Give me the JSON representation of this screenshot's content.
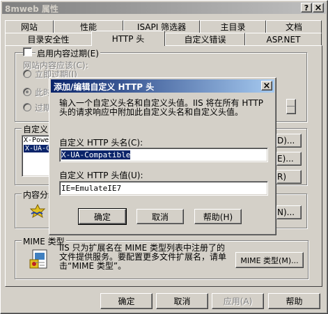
{
  "window": {
    "title": "8mweb 属性",
    "help_btn": "?",
    "close_btn": "×"
  },
  "tabs": {
    "row1": [
      "网站",
      "性能",
      "ISAPI 筛选器",
      "主目录",
      "文档"
    ],
    "row2": [
      "目录安全性",
      "HTTP 头",
      "自定义错误",
      "ASP.NET"
    ],
    "active": "HTTP 头"
  },
  "content_expire": {
    "checkbox_label": "启用内容过期(E)",
    "checked": false,
    "subtitle": "网站内容应该(C):",
    "opt_immediate": "立即过期(I)",
    "opt_after": "此时",
    "opt_at": "过期"
  },
  "custom_headers": {
    "group_label": "自定义",
    "items": [
      "X-Powe",
      "X-UA-C"
    ],
    "btn_add": "D)...",
    "btn_edit": "E)...",
    "btn_remove": "R)"
  },
  "content_rating": {
    "group_label": "内容分级",
    "btn_edit": "N)..."
  },
  "mime": {
    "group_label": "MIME 类型",
    "description": "IIS 只为扩展名在 MIME 类型列表中注册了的文件提供服务。要配置更多文件扩展名，请单击“MIME 类型”。",
    "btn": "MIME 类型(M)..."
  },
  "footer": {
    "ok": "确定",
    "cancel": "取消",
    "apply": "应用(A)",
    "help": "帮助"
  },
  "dialog": {
    "title": "添加/编辑自定义 HTTP 头",
    "close_btn": "×",
    "instructions": "输入一个自定义头名和自定义头值。IIS 将在所有 HTTP 头的请求响应中附加此自定义头名和自定义头值。",
    "name_label": "自定义 HTTP 头名(C):",
    "name_value": "X-UA-Compatible",
    "value_label": "自定义 HTTP 头值(U):",
    "value_value": "IE=EmulateIE7",
    "ok": "确定",
    "cancel": "取消",
    "help": "帮助(H)"
  }
}
